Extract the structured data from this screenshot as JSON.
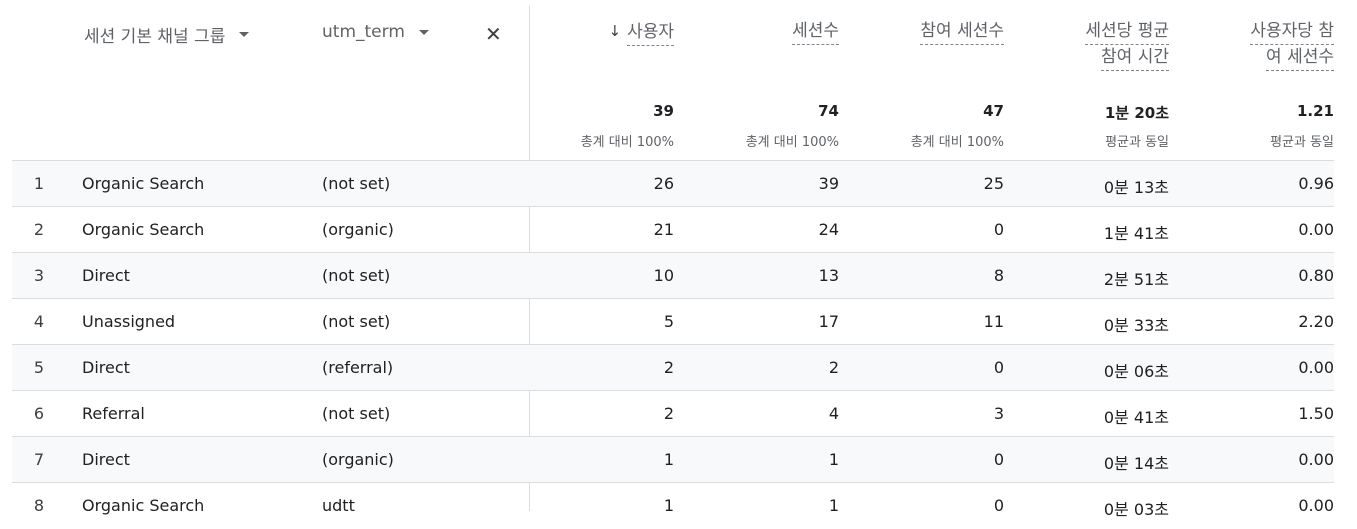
{
  "dimensions": {
    "primary_label": "세션 기본 채널 그룹",
    "secondary_label": "utm_term",
    "remove_icon": "close-icon",
    "dropdown_icon": "caret-down-icon"
  },
  "metrics": [
    {
      "key": "users",
      "label_lines": [
        "사용자"
      ],
      "sorted": true,
      "total": "39",
      "total_sub": "총계 대비 100%"
    },
    {
      "key": "sessions",
      "label_lines": [
        "세션수"
      ],
      "sorted": false,
      "total": "74",
      "total_sub": "총계 대비 100%"
    },
    {
      "key": "engaged",
      "label_lines": [
        "참여 세션수"
      ],
      "sorted": false,
      "total": "47",
      "total_sub": "총계 대비 100%"
    },
    {
      "key": "avg_time",
      "label_lines": [
        "세션당 평균",
        "참여 시간"
      ],
      "sorted": false,
      "total": "1분 20초",
      "total_sub": "평균과 동일"
    },
    {
      "key": "per_user",
      "label_lines": [
        "사용자당 참",
        "여 세션수"
      ],
      "sorted": false,
      "total": "1.21",
      "total_sub": "평균과 동일"
    }
  ],
  "sort_icon": "arrow-down-icon",
  "rows": [
    {
      "rank": "1",
      "channel": "Organic Search",
      "term": "(not set)",
      "users": "26",
      "sessions": "39",
      "engaged": "25",
      "avg_time": "0분 13초",
      "per_user": "0.96"
    },
    {
      "rank": "2",
      "channel": "Organic Search",
      "term": "(organic)",
      "users": "21",
      "sessions": "24",
      "engaged": "0",
      "avg_time": "1분 41초",
      "per_user": "0.00"
    },
    {
      "rank": "3",
      "channel": "Direct",
      "term": "(not set)",
      "users": "10",
      "sessions": "13",
      "engaged": "8",
      "avg_time": "2분 51초",
      "per_user": "0.80"
    },
    {
      "rank": "4",
      "channel": "Unassigned",
      "term": "(not set)",
      "users": "5",
      "sessions": "17",
      "engaged": "11",
      "avg_time": "0분 33초",
      "per_user": "2.20"
    },
    {
      "rank": "5",
      "channel": "Direct",
      "term": "(referral)",
      "users": "2",
      "sessions": "2",
      "engaged": "0",
      "avg_time": "0분 06초",
      "per_user": "0.00"
    },
    {
      "rank": "6",
      "channel": "Referral",
      "term": "(not set)",
      "users": "2",
      "sessions": "4",
      "engaged": "3",
      "avg_time": "0분 41초",
      "per_user": "1.50"
    },
    {
      "rank": "7",
      "channel": "Direct",
      "term": "(organic)",
      "users": "1",
      "sessions": "1",
      "engaged": "0",
      "avg_time": "0분 14초",
      "per_user": "0.00"
    },
    {
      "rank": "8",
      "channel": "Organic Search",
      "term": "udtt",
      "users": "1",
      "sessions": "1",
      "engaged": "0",
      "avg_time": "0분 03초",
      "per_user": "0.00"
    }
  ]
}
